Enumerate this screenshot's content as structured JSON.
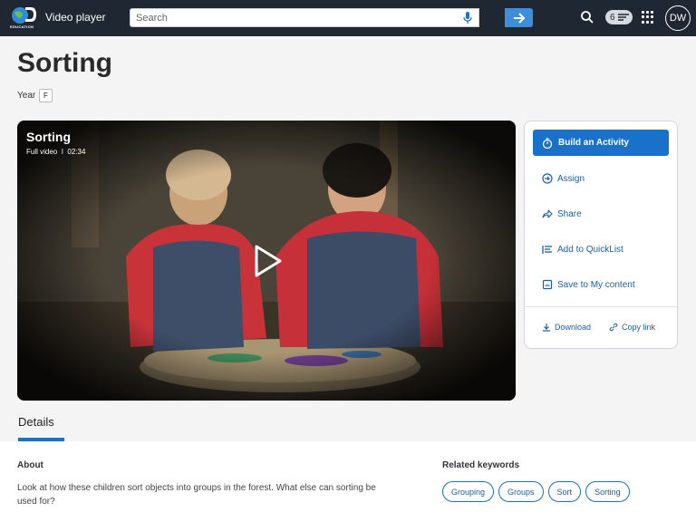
{
  "header": {
    "logo_text": "EDUCATION",
    "app_title": "Video player",
    "search_placeholder": "Search",
    "badge_count": "6",
    "avatar_initials": "DW"
  },
  "page": {
    "title": "Sorting",
    "year_label": "Year",
    "year_value": "F"
  },
  "video": {
    "title": "Sorting",
    "type": "Full video",
    "separator": "I",
    "duration": "02:34"
  },
  "actions": {
    "build": "Build an Activity",
    "assign": "Assign",
    "share": "Share",
    "quicklist": "Add to QuickList",
    "save": "Save to My content",
    "download": "Download",
    "copy_link": "Copy link"
  },
  "tabs": {
    "details": "Details"
  },
  "about": {
    "heading": "About",
    "text": "Look at how these children sort objects into groups in the forest. What else can sorting be used for?"
  },
  "keywords": {
    "heading": "Related keywords",
    "items": [
      "Grouping",
      "Groups",
      "Sort",
      "Sorting"
    ]
  },
  "colors": {
    "topbar": "#1f2733",
    "accent": "#1a71c9",
    "search_button": "#3d8fd9"
  }
}
